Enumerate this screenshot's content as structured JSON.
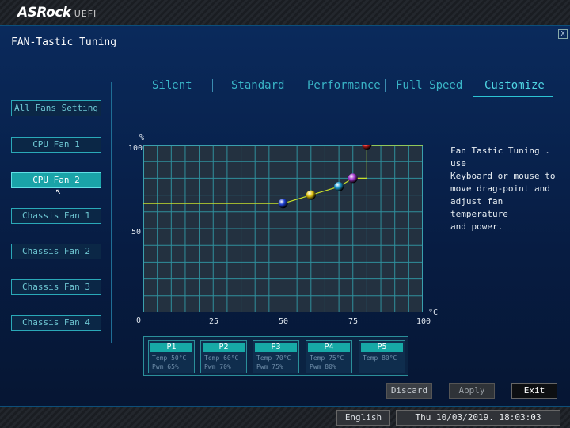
{
  "header": {
    "logo": "ASRock",
    "logo_sub": "UEFI"
  },
  "page": {
    "title": "FAN-Tastic Tuning",
    "close": "X"
  },
  "sidebar": {
    "items": [
      {
        "label": "All Fans Setting",
        "active": false
      },
      {
        "label": "CPU Fan 1",
        "active": false
      },
      {
        "label": "CPU Fan 2",
        "active": true
      },
      {
        "label": "Chassis Fan 1",
        "active": false
      },
      {
        "label": "Chassis Fan 2",
        "active": false
      },
      {
        "label": "Chassis Fan 3",
        "active": false
      },
      {
        "label": "Chassis Fan 4",
        "active": false
      }
    ]
  },
  "tabs": [
    {
      "label": "Silent",
      "active": false
    },
    {
      "label": "Standard",
      "active": false
    },
    {
      "label": "Performance",
      "active": false
    },
    {
      "label": "Full Speed",
      "active": false
    },
    {
      "label": "Customize",
      "active": true
    }
  ],
  "graph": {
    "y_unit": "%",
    "x_unit": "°C",
    "y_ticks": [
      "100",
      "50",
      "0"
    ],
    "x_ticks": [
      "25",
      "50",
      "75",
      "100"
    ],
    "x_range": [
      0,
      100
    ],
    "y_range": [
      0,
      100
    ],
    "grid": true,
    "line_color": "#c8e02a",
    "baseline_pwm": 65,
    "points": [
      {
        "name": "P1",
        "temp": 50,
        "pwm": 65,
        "color": "#1e3fd0"
      },
      {
        "name": "P2",
        "temp": 60,
        "pwm": 70,
        "color": "#e2c413"
      },
      {
        "name": "P3",
        "temp": 70,
        "pwm": 75,
        "color": "#1e9fd6"
      },
      {
        "name": "P4",
        "temp": 75,
        "pwm": 80,
        "color": "#a63ad0"
      },
      {
        "name": "P5",
        "temp": 80,
        "pwm": 100,
        "color": "#d8201e"
      }
    ]
  },
  "help_text": "Fan Tastic Tuning . use\nKeyboard or mouse to\nmove drag-point and\nadjust fan temperature\nand power.",
  "points_table": [
    {
      "name": "P1",
      "temp": "Temp 50°C",
      "pwm": "Pwm  65%"
    },
    {
      "name": "P2",
      "temp": "Temp 60°C",
      "pwm": "Pwm  70%"
    },
    {
      "name": "P3",
      "temp": "Temp 70°C",
      "pwm": "Pwm  75%"
    },
    {
      "name": "P4",
      "temp": "Temp 75°C",
      "pwm": "Pwm  80%"
    },
    {
      "name": "P5",
      "temp": "Temp 80°C",
      "pwm": ""
    }
  ],
  "actions": {
    "discard": "Discard",
    "apply": "Apply",
    "exit": "Exit"
  },
  "status": {
    "language": "English",
    "datetime": "Thu 10/03/2019. 18:03:03"
  }
}
